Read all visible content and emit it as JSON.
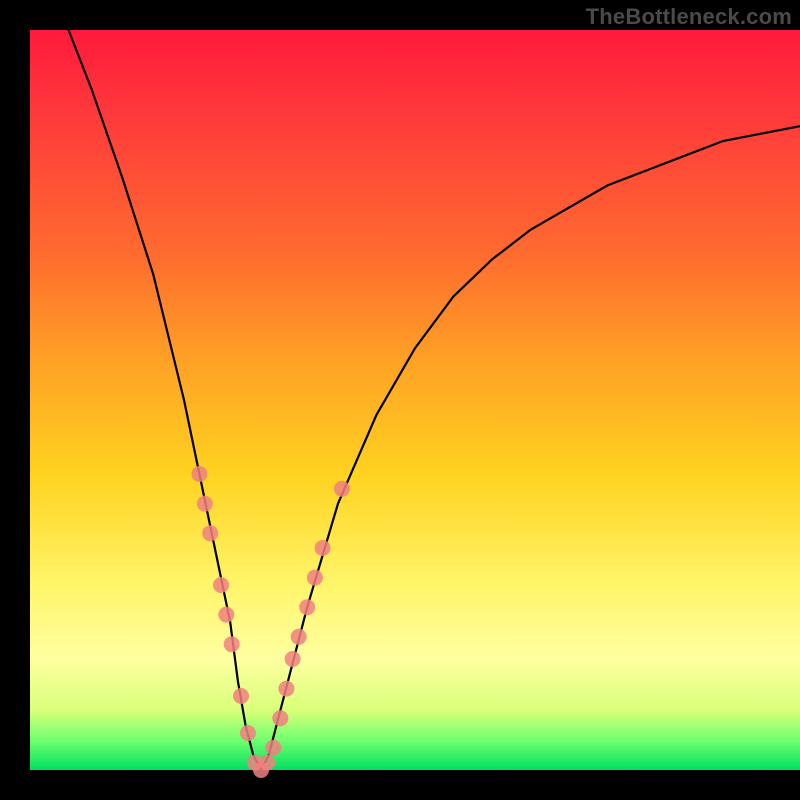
{
  "watermark": "TheBottleneck.com",
  "chart_data": {
    "type": "line",
    "title": "",
    "xlabel": "",
    "ylabel": "",
    "xlim": [
      0,
      100
    ],
    "ylim": [
      0,
      100
    ],
    "grid": false,
    "legend": false,
    "annotations": [],
    "series": [
      {
        "name": "bottleneck-curve",
        "color": "#000000",
        "x": [
          5,
          8,
          12,
          16,
          20,
          22,
          24,
          26,
          27,
          28,
          29,
          30,
          31,
          32,
          34,
          36,
          40,
          45,
          50,
          55,
          60,
          65,
          70,
          75,
          80,
          85,
          90,
          95,
          100
        ],
        "y": [
          100,
          92,
          80,
          67,
          50,
          40,
          30,
          20,
          12,
          6,
          2,
          0,
          2,
          6,
          14,
          22,
          36,
          48,
          57,
          64,
          69,
          73,
          76,
          79,
          81,
          83,
          85,
          86,
          87
        ]
      }
    ],
    "markers": [
      {
        "series": "bottleneck-curve",
        "x": 22.0,
        "y": 40,
        "color": "#f08080"
      },
      {
        "series": "bottleneck-curve",
        "x": 22.7,
        "y": 36,
        "color": "#f08080"
      },
      {
        "series": "bottleneck-curve",
        "x": 23.4,
        "y": 32,
        "color": "#f08080"
      },
      {
        "series": "bottleneck-curve",
        "x": 24.8,
        "y": 25,
        "color": "#f08080"
      },
      {
        "series": "bottleneck-curve",
        "x": 25.5,
        "y": 21,
        "color": "#f08080"
      },
      {
        "series": "bottleneck-curve",
        "x": 26.2,
        "y": 17,
        "color": "#f08080"
      },
      {
        "series": "bottleneck-curve",
        "x": 27.4,
        "y": 10,
        "color": "#f08080"
      },
      {
        "series": "bottleneck-curve",
        "x": 28.3,
        "y": 5,
        "color": "#f08080"
      },
      {
        "series": "bottleneck-curve",
        "x": 29.2,
        "y": 1,
        "color": "#f08080"
      },
      {
        "series": "bottleneck-curve",
        "x": 30.0,
        "y": 0,
        "color": "#f08080"
      },
      {
        "series": "bottleneck-curve",
        "x": 30.8,
        "y": 1,
        "color": "#f08080"
      },
      {
        "series": "bottleneck-curve",
        "x": 31.6,
        "y": 3,
        "color": "#f08080"
      },
      {
        "series": "bottleneck-curve",
        "x": 32.5,
        "y": 7,
        "color": "#f08080"
      },
      {
        "series": "bottleneck-curve",
        "x": 33.3,
        "y": 11,
        "color": "#f08080"
      },
      {
        "series": "bottleneck-curve",
        "x": 34.1,
        "y": 15,
        "color": "#f08080"
      },
      {
        "series": "bottleneck-curve",
        "x": 34.9,
        "y": 18,
        "color": "#f08080"
      },
      {
        "series": "bottleneck-curve",
        "x": 36.0,
        "y": 22,
        "color": "#f08080"
      },
      {
        "series": "bottleneck-curve",
        "x": 37.0,
        "y": 26,
        "color": "#f08080"
      },
      {
        "series": "bottleneck-curve",
        "x": 38.0,
        "y": 30,
        "color": "#f08080"
      },
      {
        "series": "bottleneck-curve",
        "x": 40.5,
        "y": 38,
        "color": "#f08080"
      }
    ],
    "gradient_bands": [
      {
        "y_from": 100,
        "y_to": 96,
        "color": "green"
      },
      {
        "y_from": 96,
        "y_to": 85,
        "color": "yellow-green"
      },
      {
        "y_from": 85,
        "y_to": 60,
        "color": "yellow"
      },
      {
        "y_from": 60,
        "y_to": 30,
        "color": "orange"
      },
      {
        "y_from": 30,
        "y_to": 0,
        "color": "red"
      }
    ]
  }
}
